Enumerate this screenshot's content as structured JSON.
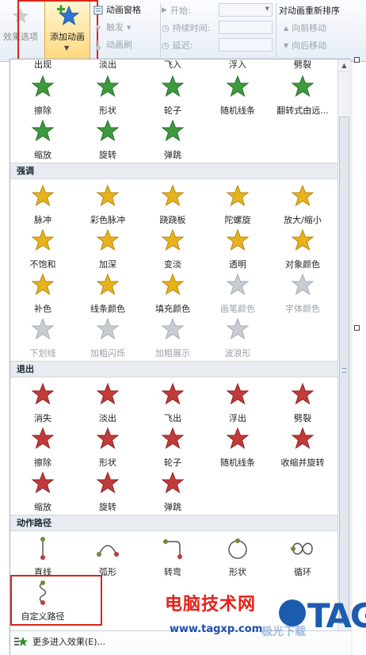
{
  "ribbon": {
    "effect_options": "效果选项",
    "add_animation": "添加动画",
    "animation_pane": "动画窗格",
    "trigger": "触发",
    "animation_painter": "动画刷",
    "start": "开始:",
    "duration": "持续时间:",
    "delay": "延迟:",
    "reorder_title": "对动画重新排序",
    "move_earlier": "向前移动",
    "move_later": "向后移动"
  },
  "gallery": {
    "partial_row": [
      "出现",
      "淡出",
      "飞入",
      "浮入",
      "劈裂"
    ],
    "entrance_rows": [
      [
        "擦除",
        "形状",
        "轮子",
        "随机线条",
        "翻转式由远..."
      ],
      [
        "缩放",
        "旋转",
        "弹跳"
      ]
    ],
    "emphasis_header": "强调",
    "emphasis_rows": [
      [
        "脉冲",
        "彩色脉冲",
        "跷跷板",
        "陀螺旋",
        "放大/缩小"
      ],
      [
        "不饱和",
        "加深",
        "变淡",
        "透明",
        "对象颜色"
      ],
      [
        "补色",
        "线条颜色",
        "填充颜色",
        "画笔颜色",
        "字体颜色"
      ],
      [
        "下划线",
        "加粗闪烁",
        "加粗展示",
        "波浪形"
      ]
    ],
    "exit_header": "退出",
    "exit_rows": [
      [
        "消失",
        "淡出",
        "飞出",
        "浮出",
        "劈裂"
      ],
      [
        "擦除",
        "形状",
        "轮子",
        "随机线条",
        "收缩并旋转"
      ],
      [
        "缩放",
        "旋转",
        "弹跳"
      ]
    ],
    "path_header": "动作路径",
    "path_rows": [
      [
        "直线",
        "弧形",
        "转弯",
        "形状",
        "循环"
      ],
      [
        "自定义路径"
      ]
    ]
  },
  "footer": {
    "more_entrance": "更多进入效果(E)..."
  },
  "watermark": {
    "site_name": "电脑技术网",
    "url": "www.tagxp.com",
    "logo": "TAG",
    "sub": "极光下载"
  },
  "colors": {
    "entrance": "#3c9a3c",
    "emphasis": "#e7b21c",
    "exit": "#c23a3a",
    "path": "#6a8c3a",
    "highlight": "#d8261b"
  }
}
